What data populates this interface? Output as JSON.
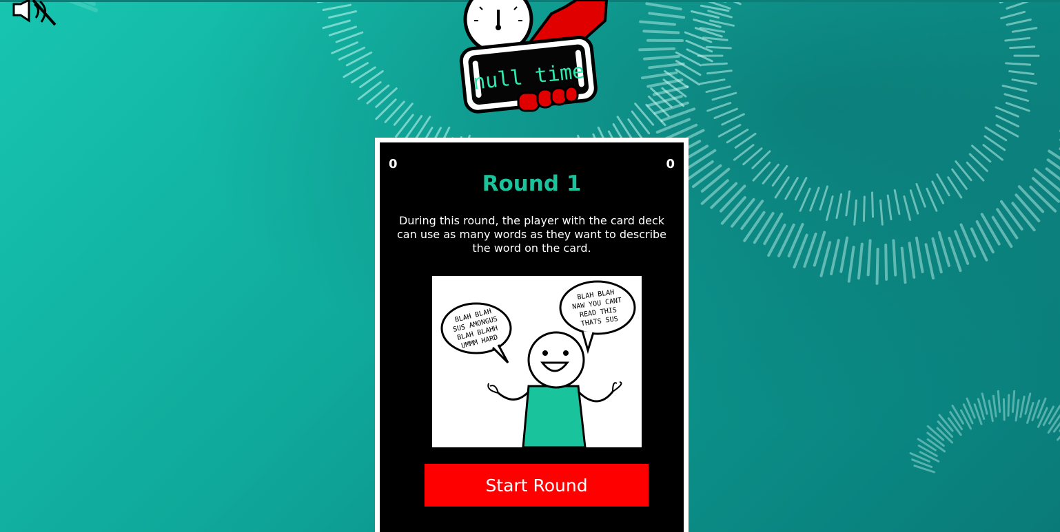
{
  "logo": {
    "text": "null time"
  },
  "mute": {
    "icon": "speaker-muted-icon"
  },
  "card": {
    "score_left": "0",
    "score_right": "0",
    "title": "Round 1",
    "description": "During this round, the player with the card deck can use as many words as they want to describe the word on the card.",
    "illustration": {
      "bubble_left": [
        "BLAH BLAH",
        "SUS AMONGUS",
        "BLAH BLAHH",
        "UMMM HARD"
      ],
      "bubble_right": [
        "BLAH BLAH",
        "NAW YOU CANT",
        "READ THIS",
        "THATS SUS"
      ]
    },
    "start_button": "Start Round"
  },
  "colors": {
    "accent_green": "#19c39c",
    "button_red": "#ff0000",
    "card_bg": "#000000"
  }
}
